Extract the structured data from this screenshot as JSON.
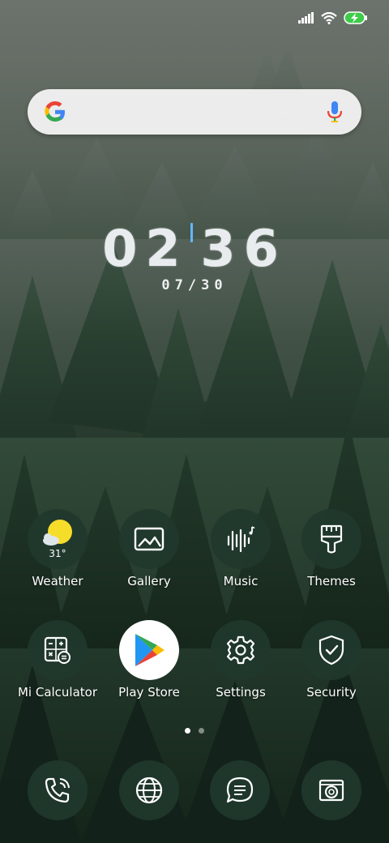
{
  "clock": {
    "hours": "02",
    "minutes": "36"
  },
  "date": "07/30",
  "weather": {
    "temperature": "31°"
  },
  "apps": {
    "weather": "Weather",
    "gallery": "Gallery",
    "music": "Music",
    "themes": "Themes",
    "calculator": "Mi Calculator",
    "play_store": "Play Store",
    "settings": "Settings",
    "security": "Security"
  },
  "pager": {
    "pages": 2,
    "current": 1
  },
  "colors": {
    "clock_separator": "#63b7ff",
    "icon_circle": "#21382c",
    "weather_sun": "#f5dd2a"
  },
  "icons": {
    "status": [
      "signal-icon",
      "wifi-icon",
      "battery-charging-icon"
    ],
    "dock": [
      "phone-icon",
      "browser-icon",
      "messages-icon",
      "camera-icon"
    ]
  }
}
